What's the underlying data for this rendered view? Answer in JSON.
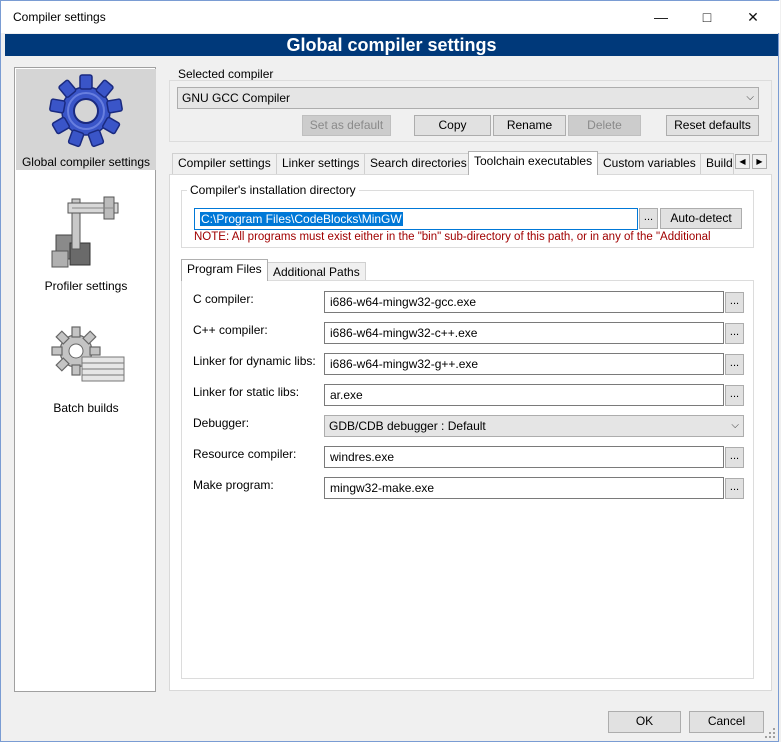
{
  "window": {
    "title": "Compiler settings",
    "minimize": "—",
    "maximize": "□",
    "close": "✕"
  },
  "header": {
    "title": "Global compiler settings"
  },
  "sidebar": {
    "items": [
      {
        "label": "Global compiler settings",
        "icon": "gear-icon",
        "selected": true
      },
      {
        "label": "Profiler settings",
        "icon": "caliper-icon",
        "selected": false
      },
      {
        "label": "Batch builds",
        "icon": "batch-gear-icon",
        "selected": false
      }
    ]
  },
  "compiler": {
    "section_label": "Selected compiler",
    "value": "GNU GCC Compiler",
    "buttons": {
      "set_default": "Set as default",
      "copy": "Copy",
      "rename": "Rename",
      "delete": "Delete",
      "reset": "Reset defaults"
    }
  },
  "tabs": [
    "Compiler settings",
    "Linker settings",
    "Search directories",
    "Toolchain executables",
    "Custom variables",
    "Build"
  ],
  "install": {
    "legend": "Compiler's installation directory",
    "path": "C:\\Program Files\\CodeBlocks\\MinGW",
    "browse": "...",
    "autodetect": "Auto-detect",
    "note": "NOTE: All programs must exist either in the \"bin\" sub-directory of this path, or in any of the \"Additional"
  },
  "subtabs": [
    "Program Files",
    "Additional Paths"
  ],
  "programs": [
    {
      "label": "C compiler:",
      "value": "i686-w64-mingw32-gcc.exe",
      "type": "text"
    },
    {
      "label": "C++ compiler:",
      "value": "i686-w64-mingw32-c++.exe",
      "type": "text"
    },
    {
      "label": "Linker for dynamic libs:",
      "value": "i686-w64-mingw32-g++.exe",
      "type": "text"
    },
    {
      "label": "Linker for static libs:",
      "value": "ar.exe",
      "type": "text"
    },
    {
      "label": "Debugger:",
      "value": "GDB/CDB debugger : Default",
      "type": "select"
    },
    {
      "label": "Resource compiler:",
      "value": "windres.exe",
      "type": "text"
    },
    {
      "label": "Make program:",
      "value": "mingw32-make.exe",
      "type": "text"
    }
  ],
  "footer": {
    "ok": "OK",
    "cancel": "Cancel"
  },
  "colors": {
    "header_bg": "#00397a",
    "note": "#a00000",
    "selection": "#0078d7"
  }
}
